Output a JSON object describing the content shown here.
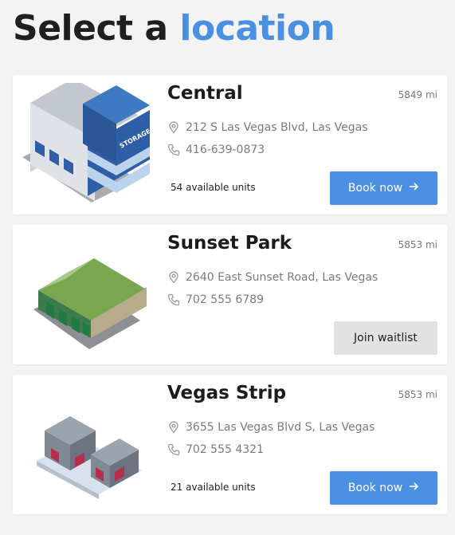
{
  "header": {
    "title_prefix": "Select a",
    "title_accent": "location"
  },
  "colors": {
    "accent": "#4a90e2",
    "secondary_button": "#e2e2e2"
  },
  "locations": [
    {
      "name": "Central",
      "distance": "5849 mi",
      "address": "212 S Las Vegas Blvd, Las Vegas",
      "phone": "416-639-0873",
      "availability": "54 available units",
      "action": "Book now",
      "image_label": "STORAGE"
    },
    {
      "name": "Sunset Park",
      "distance": "5853 mi",
      "address": "2640 East Sunset Road, Las Vegas",
      "phone": "702 555 6789",
      "action": "Join waitlist"
    },
    {
      "name": "Vegas Strip",
      "distance": "5853 mi",
      "address": "3655 Las Vegas Blvd S, Las Vegas",
      "phone": "702 555 4321",
      "availability": "21 available units",
      "action": "Book now"
    }
  ],
  "icons": {
    "address": "map-pin-icon",
    "phone": "phone-icon",
    "action": "arrow-right-icon"
  }
}
